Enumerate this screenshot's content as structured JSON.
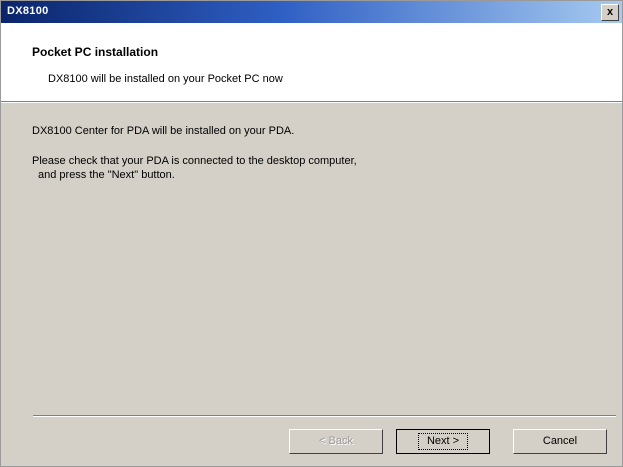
{
  "window": {
    "title": "DX8100",
    "close_glyph": "x"
  },
  "header": {
    "title": "Pocket PC installation",
    "subtitle": "DX8100 will be installed on your Pocket PC now"
  },
  "body": {
    "line1": "DX8100 Center for PDA will be installed on your PDA.",
    "line2": "Please check that your PDA is connected to the desktop computer,",
    "line3": "and press the \"Next\" button."
  },
  "buttons": {
    "back": {
      "label": "< Back",
      "enabled": false
    },
    "next": {
      "label": "Next >",
      "enabled": true,
      "focused": true
    },
    "cancel": {
      "label": "Cancel",
      "enabled": true
    }
  },
  "colors": {
    "titlebar_start": "#0a246a",
    "titlebar_end": "#a6caf0",
    "dialog_face": "#d4d0c8",
    "header_bg": "#ffffff"
  }
}
